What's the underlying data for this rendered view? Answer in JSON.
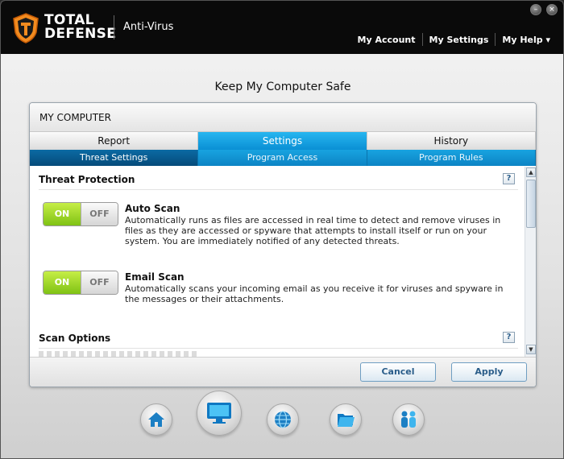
{
  "header": {
    "brand_line1": "TOTAL",
    "brand_line2": "DEFENSE",
    "product": "Anti-Virus",
    "nav": [
      {
        "label": "My Account"
      },
      {
        "label": "My Settings"
      },
      {
        "label": "My Help ▾"
      }
    ],
    "window_buttons": [
      {
        "icon": "minimize-icon",
        "glyph": "–"
      },
      {
        "icon": "close-icon",
        "glyph": "×"
      }
    ]
  },
  "page_title": "Keep My Computer Safe",
  "panel": {
    "title": "MY COMPUTER",
    "tabs": [
      {
        "label": "Report",
        "active": false
      },
      {
        "label": "Settings",
        "active": true
      },
      {
        "label": "History",
        "active": false
      }
    ],
    "subtabs": [
      {
        "label": "Threat Settings",
        "active": true
      },
      {
        "label": "Program Access",
        "active": false
      },
      {
        "label": "Program Rules",
        "active": false
      }
    ],
    "sections": [
      {
        "title": "Threat Protection",
        "help": "?",
        "items": [
          {
            "toggle_on": "ON",
            "toggle_off": "OFF",
            "state": "on",
            "title": "Auto Scan",
            "desc": "Automatically runs as files are accessed in real time to detect and remove viruses in files as they are accessed or spyware that attempts to install itself or run on your system. You are immediately notified of any detected threats."
          },
          {
            "toggle_on": "ON",
            "toggle_off": "OFF",
            "state": "on",
            "title": "Email Scan",
            "desc": "Automatically scans your incoming email as you receive it for viruses and spyware in the messages or their attachments."
          }
        ]
      },
      {
        "title": "Scan Options",
        "help": "?"
      }
    ],
    "buttons": {
      "cancel": "Cancel",
      "apply": "Apply"
    }
  },
  "dock": [
    {
      "icon": "home-icon",
      "active": false
    },
    {
      "icon": "computer-icon",
      "active": true
    },
    {
      "icon": "globe-icon",
      "active": false
    },
    {
      "icon": "folders-icon",
      "active": false
    },
    {
      "icon": "family-icon",
      "active": false
    }
  ],
  "colors": {
    "accent_blue": "#0a8fd4",
    "toggle_green": "#7fc214",
    "header_bg": "#0a0a0a"
  }
}
